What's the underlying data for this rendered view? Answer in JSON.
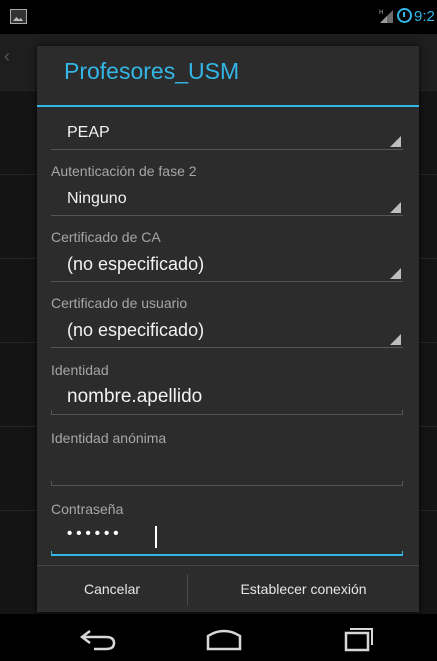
{
  "status_bar": {
    "time": "9:2",
    "icons": [
      "notification-image-icon",
      "signal-icon",
      "alarm-icon"
    ]
  },
  "dialog": {
    "title": "Profesores_USM",
    "eap_method": {
      "value": "PEAP"
    },
    "phase2": {
      "label": "Autenticación de fase 2",
      "value": "Ninguno"
    },
    "ca_cert": {
      "label": "Certificado de CA",
      "value": "(no especificado)"
    },
    "user_cert": {
      "label": "Certificado de usuario",
      "value": "(no especificado)"
    },
    "identity": {
      "label": "Identidad",
      "value": "nombre.apellido"
    },
    "anonymous_identity": {
      "label": "Identidad anónima",
      "value": ""
    },
    "password": {
      "label": "Contraseña",
      "value": "••••••"
    },
    "buttons": {
      "cancel": "Cancelar",
      "connect": "Establecer conexión"
    }
  },
  "nav_bar": {
    "icons": [
      "back-icon",
      "home-icon",
      "recent-apps-icon"
    ]
  },
  "colors": {
    "accent": "#33b5e5",
    "dialog_bg": "#2c2c2c"
  }
}
